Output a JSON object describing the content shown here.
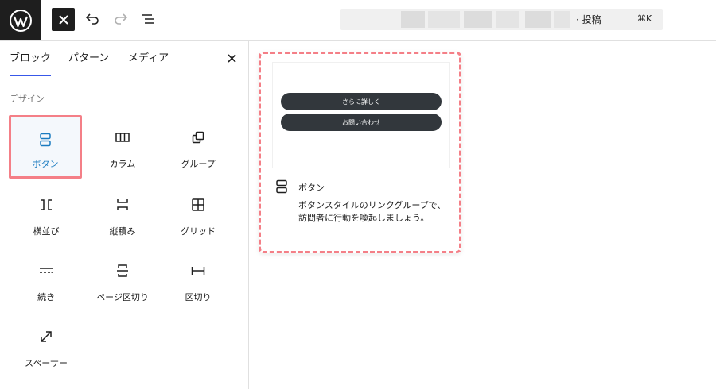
{
  "topbar": {
    "logo_icon": "wordpress-icon",
    "close_icon": "close-icon",
    "undo_icon": "undo-icon",
    "redo_icon": "redo-icon",
    "list_view_icon": "list-view-icon",
    "command_title": "· 投稿",
    "command_shortcut": "⌘K"
  },
  "sidebar": {
    "tabs": [
      {
        "label": "ブロック",
        "active": true
      },
      {
        "label": "パターン",
        "active": false
      },
      {
        "label": "メディア",
        "active": false
      }
    ],
    "close_icon": "close-icon",
    "section_title": "デザイン",
    "blocks": [
      {
        "label": "ボタン",
        "icon": "buttons-icon",
        "selected": true
      },
      {
        "label": "カラム",
        "icon": "columns-icon",
        "selected": false
      },
      {
        "label": "グループ",
        "icon": "group-icon",
        "selected": false
      },
      {
        "label": "横並び",
        "icon": "row-icon",
        "selected": false
      },
      {
        "label": "縦積み",
        "icon": "stack-icon",
        "selected": false
      },
      {
        "label": "グリッド",
        "icon": "grid-icon",
        "selected": false
      },
      {
        "label": "続き",
        "icon": "more-icon",
        "selected": false
      },
      {
        "label": "ページ区切り",
        "icon": "page-break-icon",
        "selected": false
      },
      {
        "label": "区切り",
        "icon": "separator-icon",
        "selected": false
      },
      {
        "label": "スペーサー",
        "icon": "spacer-icon",
        "selected": false
      }
    ]
  },
  "preview": {
    "buttons": [
      "さらに詳しく",
      "お問い合わせ"
    ],
    "title": "ボタン",
    "description": "ボタンスタイルのリンクグループで、訪問者に行動を喚起しましょう。"
  },
  "colors": {
    "highlight": "#f47f87",
    "accent": "#3858e9",
    "selected_label": "#1a7bc0",
    "button_bg": "#32373c"
  }
}
